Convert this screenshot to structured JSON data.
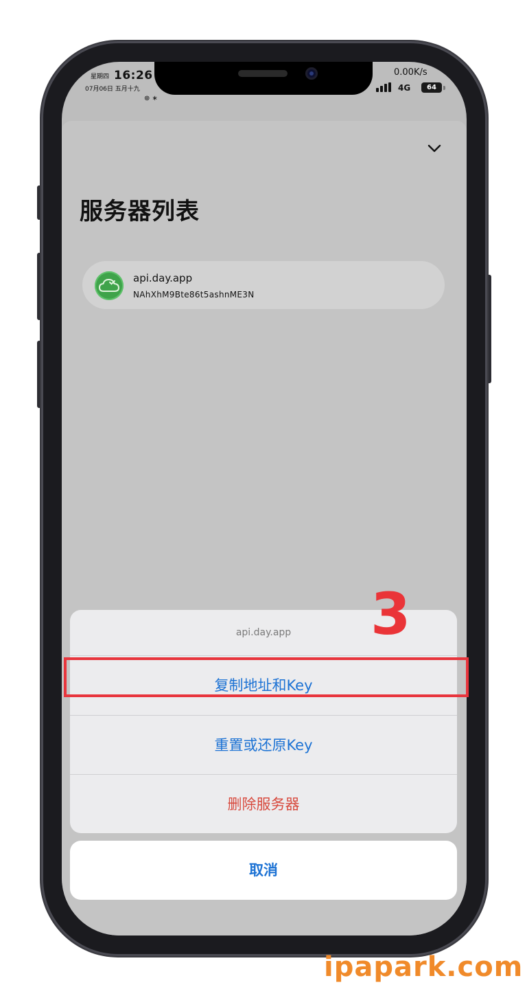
{
  "status_bar": {
    "weekday": "星期四",
    "time": "16:26",
    "date": "07月06日 五月十九",
    "status_icons": "⊕ ∗",
    "network_speed": "0.00K/s",
    "network_type": "4G",
    "battery_level": "64"
  },
  "sheet": {
    "title": "服务器列表",
    "collapse_icon": "chevron-down-icon"
  },
  "server": {
    "host": "api.day.app",
    "key": "NAhXhM9Bte86t5ashnME3N",
    "avatar_color": "#3fa34a"
  },
  "action_sheet": {
    "title": "api.day.app",
    "copy_label": "复制地址和Key",
    "reset_label": "重置或还原Key",
    "delete_label": "删除服务器",
    "cancel_label": "取消",
    "action_color": "#1c72d4",
    "danger_color": "#d84a3e"
  },
  "annotation": {
    "step": "3",
    "highlight_color": "#e8353d"
  },
  "watermark": "ipapark.com"
}
